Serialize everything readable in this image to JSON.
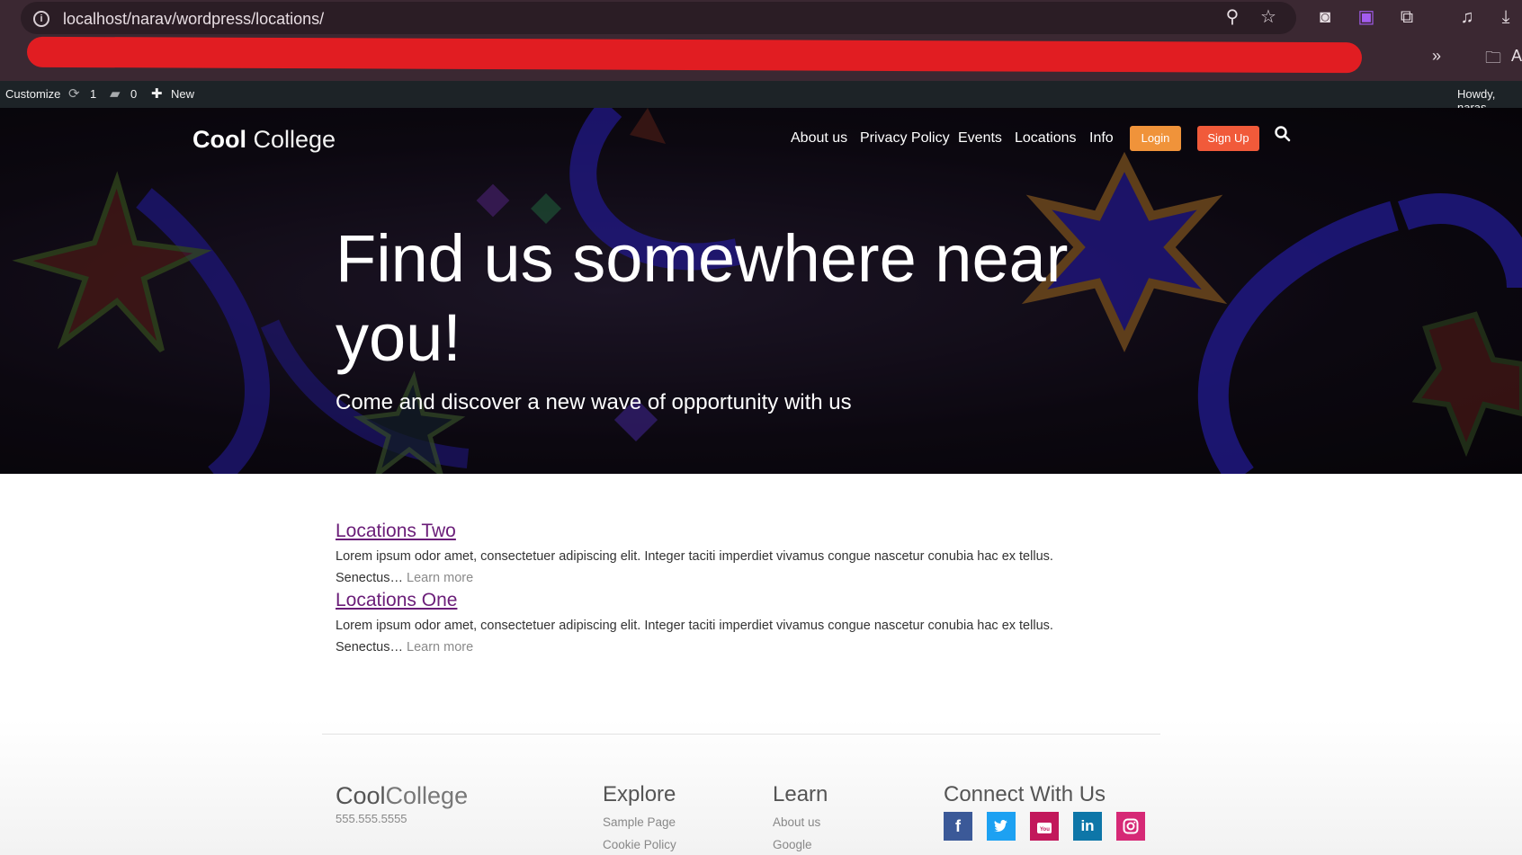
{
  "browser": {
    "url": "localhost/narav/wordpress/locations/",
    "bookmarks_overflow": "»",
    "bookmark_folder_label": "A"
  },
  "adminbar": {
    "customize": "Customize",
    "updates_count": "1",
    "comments_count": "0",
    "new_label": "New",
    "howdy": "Howdy, naras"
  },
  "header": {
    "logo_bold": "Cool",
    "logo_light": "College",
    "nav": [
      "About us",
      "Privacy Policy",
      "Events",
      "Locations",
      "Info"
    ],
    "login": "Login",
    "signup": "Sign Up",
    "colors": {
      "login": "#f0933a",
      "signup": "#f15a3a"
    }
  },
  "hero": {
    "title": "Find us somewhere near you!",
    "subtitle": "Come and discover a new wave of opportunity with us"
  },
  "locations": [
    {
      "title": "Locations Two",
      "excerpt": "Lorem ipsum odor amet, consectetuer adipiscing elit. Integer taciti imperdiet vivamus congue nascetur conubia hac ex tellus. Senectus…",
      "more": "Learn more"
    },
    {
      "title": "Locations One",
      "excerpt": "Lorem ipsum odor amet, consectetuer adipiscing elit. Integer taciti imperdiet vivamus congue nascetur conubia hac ex tellus. Senectus…",
      "more": "Learn more"
    }
  ],
  "footer": {
    "logo_bold": "Cool",
    "logo_light": "College",
    "phone": "555.555.5555",
    "explore": {
      "heading": "Explore",
      "links": [
        "Sample Page",
        "Cookie Policy"
      ]
    },
    "learn": {
      "heading": "Learn",
      "links": [
        "About us",
        "Google"
      ]
    },
    "connect": {
      "heading": "Connect With Us",
      "social": [
        {
          "name": "facebook-icon",
          "glyph": "f",
          "color": "#3b5998"
        },
        {
          "name": "twitter-icon",
          "glyph": "🐦",
          "color": "#1da1f2"
        },
        {
          "name": "youtube-icon",
          "glyph": "▶",
          "color": "#c2185b"
        },
        {
          "name": "linkedin-icon",
          "glyph": "in",
          "color": "#0e76a8"
        },
        {
          "name": "instagram-icon",
          "glyph": "◎",
          "color": "#d62976"
        }
      ]
    }
  }
}
